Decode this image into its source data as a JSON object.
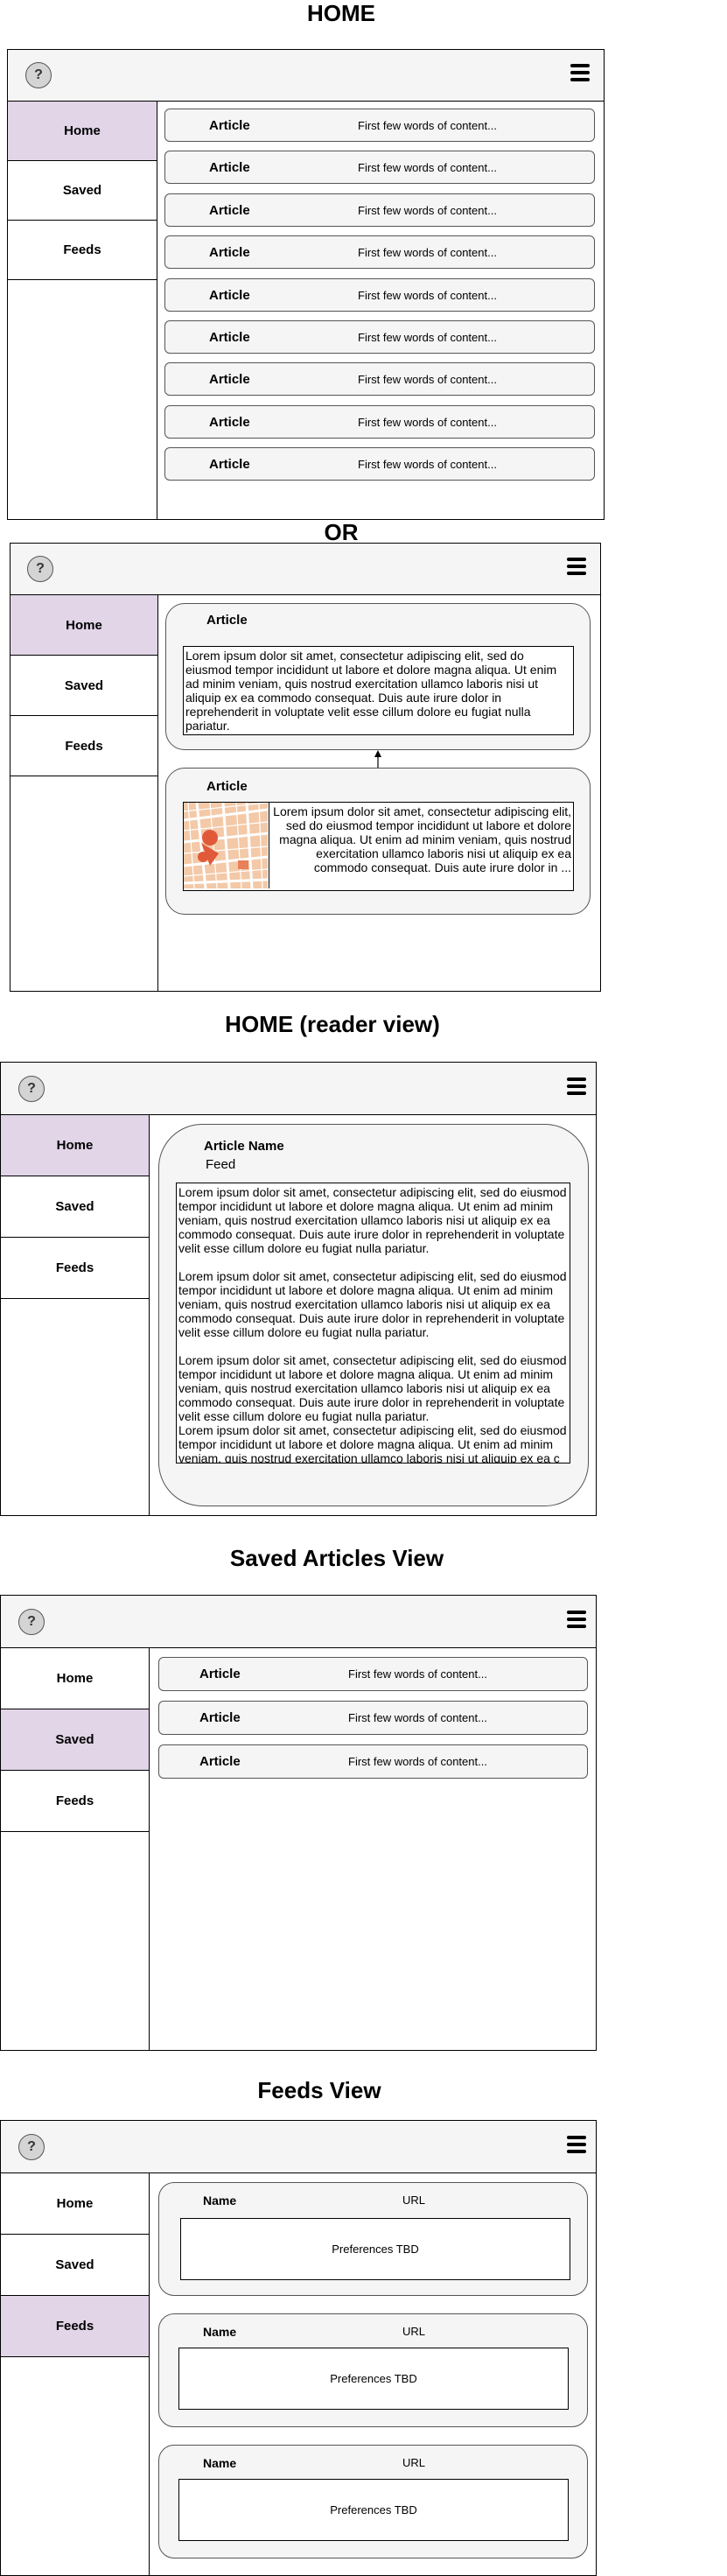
{
  "titles": {
    "home": "HOME",
    "or": "OR",
    "reader": "HOME (reader view)",
    "saved": "Saved Articles View",
    "feeds": "Feeds View"
  },
  "header": {
    "help_glyph": "?",
    "menu_icon": "hamburger-menu-icon"
  },
  "nav": {
    "home": "Home",
    "saved": "Saved",
    "feeds": "Feeds"
  },
  "active_color": "#e1d5e7",
  "article_row": {
    "label": "Article",
    "preview": "First few words of content..."
  },
  "card_view": {
    "article1_label": "Article",
    "article1_text": "Lorem ipsum dolor sit amet, consectetur adipiscing elit, sed do eiusmod tempor incididunt ut labore et dolore magna aliqua. Ut enim ad minim veniam, quis nostrud exercitation ullamco laboris nisi ut aliquip ex ea commodo consequat. Duis aute irure dolor in reprehenderit in voluptate velit esse cillum dolore eu fugiat nulla pariatur.",
    "article2_label": "Article",
    "article2_text": "Lorem ipsum dolor sit amet, consectetur adipiscing elit, sed do eiusmod tempor incididunt ut labore et dolore magna aliqua. Ut enim ad minim veniam, quis nostrud exercitation ullamco laboris nisi ut aliquip ex ea commodo consequat. Duis aute irure dolor in ..."
  },
  "reader": {
    "article_name": "Article Name",
    "feed": "Feed",
    "para1": "Lorem ipsum dolor sit amet, consectetur adipiscing elit, sed do eiusmod tempor incididunt ut labore et dolore magna aliqua. Ut enim ad minim veniam, quis nostrud exercitation ullamco laboris nisi ut aliquip ex ea commodo consequat. Duis aute irure dolor in reprehenderit in voluptate velit esse cillum dolore eu fugiat nulla pariatur.",
    "para2": "Lorem ipsum dolor sit amet, consectetur adipiscing elit, sed do eiusmod tempor incididunt ut labore et dolore magna aliqua. Ut enim ad minim veniam, quis nostrud exercitation ullamco laboris nisi ut aliquip ex ea commodo consequat. Duis aute irure dolor in reprehenderit in voluptate velit esse cillum dolore eu fugiat nulla pariatur.",
    "para3": "Lorem ipsum dolor sit amet, consectetur adipiscing elit, sed do eiusmod tempor incididunt ut labore et dolore magna aliqua. Ut enim ad minim veniam, quis nostrud exercitation ullamco laboris nisi ut aliquip ex ea commodo consequat. Duis aute irure dolor in reprehenderit in voluptate velit esse cillum dolore eu fugiat nulla pariatur.",
    "para4": "Lorem ipsum dolor sit amet, consectetur adipiscing elit, sed do eiusmod tempor incididunt ut labore et dolore magna aliqua. Ut enim ad minim veniam, quis nostrud exercitation ullamco laboris nisi ut aliquip ex ea c"
  },
  "feed_card": {
    "name": "Name",
    "url": "URL",
    "prefs": "Preferences TBD"
  }
}
